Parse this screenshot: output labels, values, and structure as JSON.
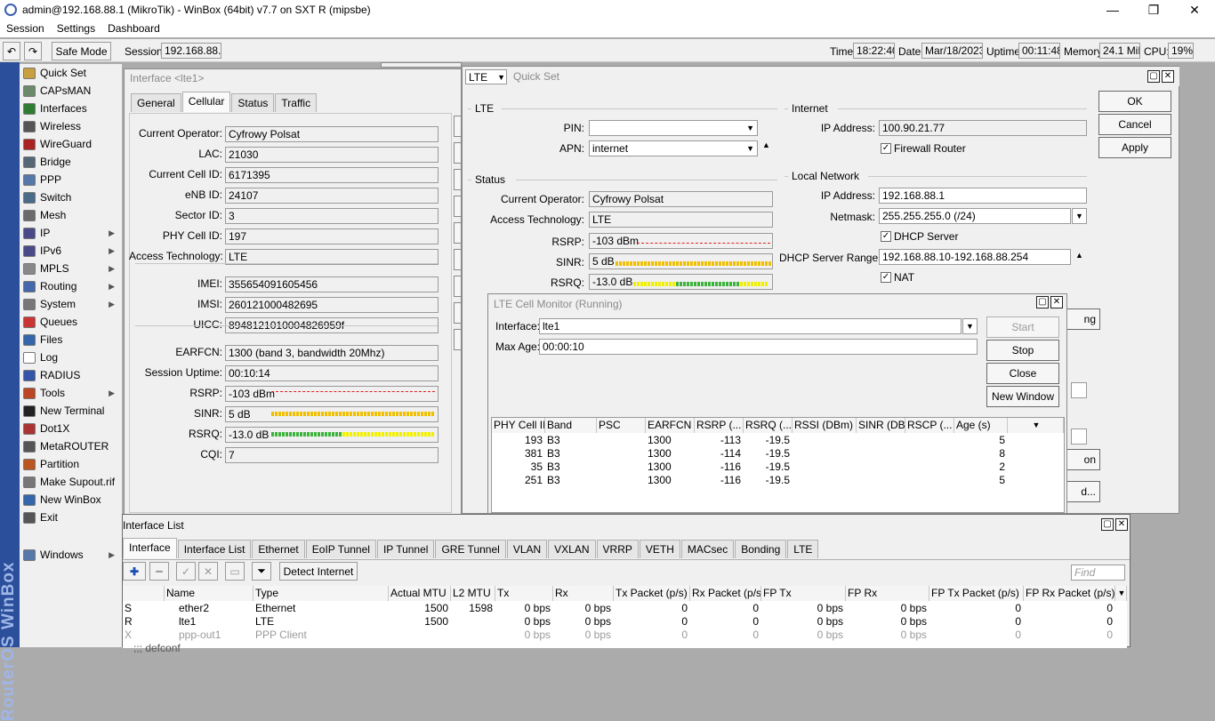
{
  "window": {
    "title": "admin@192.168.88.1 (MikroTik) - WinBox (64bit) v7.7 on SXT R (mipsbe)",
    "minimize": "—",
    "maximize": "❐",
    "close": "✕"
  },
  "menubar": [
    "Session",
    "Settings",
    "Dashboard"
  ],
  "toolbar": {
    "undo": "↶",
    "redo": "↷",
    "safe_mode": "Safe Mode",
    "session_label": "Session:",
    "session_value": "192.168.88.1",
    "time_label": "Time:",
    "time_value": "18:22:40",
    "date_label": "Date:",
    "date_value": "Mar/18/2023",
    "uptime_label": "Uptime:",
    "uptime_value": "00:11:48",
    "memory_label": "Memory:",
    "memory_value": "24.1 MiB",
    "cpu_label": "CPU:",
    "cpu_value": "19%"
  },
  "sidebar": {
    "brand": "RouterOS WinBox",
    "items": [
      {
        "label": "Quick Set",
        "icon": "wand-icon",
        "color": "#c8a040"
      },
      {
        "label": "CAPsMAN",
        "icon": "capsman-icon",
        "color": "#6a8a6a"
      },
      {
        "label": "Interfaces",
        "icon": "interfaces-icon",
        "color": "#2e7d32"
      },
      {
        "label": "Wireless",
        "icon": "wireless-icon",
        "color": "#555555"
      },
      {
        "label": "WireGuard",
        "icon": "wireguard-icon",
        "color": "#aa2222"
      },
      {
        "label": "Bridge",
        "icon": "bridge-icon",
        "color": "#556677"
      },
      {
        "label": "PPP",
        "icon": "ppp-icon",
        "color": "#5577aa"
      },
      {
        "label": "Switch",
        "icon": "switch-icon",
        "color": "#4a6a8a"
      },
      {
        "label": "Mesh",
        "icon": "mesh-icon",
        "color": "#6a6a6a"
      },
      {
        "label": "IP",
        "icon": "ip-icon",
        "color": "#4a4a8a",
        "sub": true
      },
      {
        "label": "IPv6",
        "icon": "ipv6-icon",
        "color": "#4a4a8a",
        "sub": true
      },
      {
        "label": "MPLS",
        "icon": "mpls-icon",
        "color": "#888888",
        "sub": true
      },
      {
        "label": "Routing",
        "icon": "routing-icon",
        "color": "#4466aa",
        "sub": true
      },
      {
        "label": "System",
        "icon": "system-icon",
        "color": "#777777",
        "sub": true
      },
      {
        "label": "Queues",
        "icon": "queues-icon",
        "color": "#cc3333"
      },
      {
        "label": "Files",
        "icon": "files-icon",
        "color": "#3366aa"
      },
      {
        "label": "Log",
        "icon": "log-icon",
        "color": "#ffffff"
      },
      {
        "label": "RADIUS",
        "icon": "radius-icon",
        "color": "#3355aa"
      },
      {
        "label": "Tools",
        "icon": "tools-icon",
        "color": "#bb4422",
        "sub": true
      },
      {
        "label": "New Terminal",
        "icon": "terminal-icon",
        "color": "#222222"
      },
      {
        "label": "Dot1X",
        "icon": "dot1x-icon",
        "color": "#aa3333"
      },
      {
        "label": "MetaROUTER",
        "icon": "metarouter-icon",
        "color": "#555555"
      },
      {
        "label": "Partition",
        "icon": "partition-icon",
        "color": "#bb5522"
      },
      {
        "label": "Make Supout.rif",
        "icon": "supout-icon",
        "color": "#777777"
      },
      {
        "label": "New WinBox",
        "icon": "winbox-icon",
        "color": "#3366aa"
      },
      {
        "label": "Exit",
        "icon": "exit-icon",
        "color": "#555555"
      },
      {
        "label": "Windows",
        "icon": "windows-icon",
        "color": "#5577aa",
        "sub": true
      }
    ]
  },
  "interface_win": {
    "title": "Interface <lte1>",
    "tabs": [
      "General",
      "Cellular",
      "Status",
      "Traffic"
    ],
    "fields": [
      {
        "label": "Current Operator:",
        "value": "Cyfrowy Polsat"
      },
      {
        "label": "LAC:",
        "value": "21030"
      },
      {
        "label": "Current Cell ID:",
        "value": "6171395"
      },
      {
        "label": "eNB ID:",
        "value": "24107"
      },
      {
        "label": "Sector ID:",
        "value": "3"
      },
      {
        "label": "PHY Cell ID:",
        "value": "197"
      },
      {
        "label": "Access Technology:",
        "value": "LTE"
      },
      {
        "label": "IMEI:",
        "value": "355654091605456"
      },
      {
        "label": "IMSI:",
        "value": "260121000482695"
      },
      {
        "label": "UICC:",
        "value": "8948121010004826959f"
      },
      {
        "label": "EARFCN:",
        "value": "1300 (band 3, bandwidth 20Mhz)"
      },
      {
        "label": "Session Uptime:",
        "value": "00:10:14"
      },
      {
        "label": "RSRP:",
        "value": "-103 dBm"
      },
      {
        "label": "SINR:",
        "value": "5 dB"
      },
      {
        "label": "RSRQ:",
        "value": "-13.0 dB"
      },
      {
        "label": "CQI:",
        "value": "7"
      }
    ]
  },
  "quickset": {
    "title": "Quick Set",
    "mode": "LTE",
    "lte_group": "LTE",
    "pin_label": "PIN:",
    "pin_value": "",
    "apn_label": "APN:",
    "apn_value": "internet",
    "status_group": "Status",
    "operator_label": "Current Operator:",
    "operator_value": "Cyfrowy Polsat",
    "tech_label": "Access Technology:",
    "tech_value": "LTE",
    "rsrp_label": "RSRP:",
    "rsrp_value": "-103 dBm",
    "sinr_label": "SINR:",
    "sinr_value": "5 dB",
    "rsrq_label": "RSRQ:",
    "rsrq_value": "-13.0 dB",
    "internet_group": "Internet",
    "ip_label": "IP Address:",
    "ip_value": "100.90.21.77",
    "firewall_label": "Firewall Router",
    "local_group": "Local Network",
    "lan_ip_label": "IP Address:",
    "lan_ip_value": "192.168.88.1",
    "netmask_label": "Netmask:",
    "netmask_value": "255.255.255.0 (/24)",
    "dhcp_label": "DHCP Server",
    "dhcp_range_label": "DHCP Server Range:",
    "dhcp_range_value": "192.168.88.10-192.168.88.254",
    "nat_label": "NAT",
    "ok": "OK",
    "cancel": "Cancel",
    "apply": "Apply",
    "partial1": "ng",
    "partial2": "on",
    "partial3": "d..."
  },
  "cellmon": {
    "title": "LTE Cell Monitor (Running)",
    "interface_label": "Interface:",
    "interface_value": "lte1",
    "maxage_label": "Max Age:",
    "maxage_value": "00:00:10",
    "start": "Start",
    "stop": "Stop",
    "close": "Close",
    "new_window": "New Window",
    "headers": [
      "PHY Cell ID",
      "Band",
      "PSC",
      "EARFCN",
      "RSRP (...",
      "RSRQ (...",
      "RSSI (DBm)",
      "SINR (DB)",
      "RSCP (...",
      "Age (s)"
    ],
    "rows": [
      [
        "193",
        "B3",
        "",
        "1300",
        "-113",
        "-19.5",
        "",
        "",
        "",
        "5"
      ],
      [
        "381",
        "B3",
        "",
        "1300",
        "-114",
        "-19.5",
        "",
        "",
        "",
        "8"
      ],
      [
        "35",
        "B3",
        "",
        "1300",
        "-116",
        "-19.5",
        "",
        "",
        "",
        "2"
      ],
      [
        "251",
        "B3",
        "",
        "1300",
        "-116",
        "-19.5",
        "",
        "",
        "",
        "5"
      ]
    ]
  },
  "iflist": {
    "title": "Interface List",
    "tabs": [
      "Interface",
      "Interface List",
      "Ethernet",
      "EoIP Tunnel",
      "IP Tunnel",
      "GRE Tunnel",
      "VLAN",
      "VXLAN",
      "VRRP",
      "VETH",
      "MACsec",
      "Bonding",
      "LTE"
    ],
    "detect": "Detect Internet",
    "find_placeholder": "Find",
    "headers": [
      "",
      "Name",
      "Type",
      "Actual MTU",
      "L2 MTU",
      "Tx",
      "Rx",
      "Tx Packet (p/s)",
      "Rx Packet (p/s)",
      "FP Tx",
      "FP Rx",
      "FP Tx Packet (p/s)",
      "FP Rx Packet (p/s)"
    ],
    "rows": [
      [
        "S",
        "ether2",
        "Ethernet",
        "1500",
        "1598",
        "0 bps",
        "0 bps",
        "0",
        "0",
        "0 bps",
        "0 bps",
        "0",
        "0"
      ],
      [
        "R",
        "lte1",
        "LTE",
        "1500",
        "",
        "0 bps",
        "0 bps",
        "0",
        "0",
        "0 bps",
        "0 bps",
        "0",
        "0"
      ],
      [
        "X",
        "ppp-out1",
        "PPP Client",
        "",
        "",
        "0 bps",
        "0 bps",
        "0",
        "0",
        "0 bps",
        "0 bps",
        "0",
        "0"
      ]
    ],
    "comment": ";;; defconf"
  }
}
